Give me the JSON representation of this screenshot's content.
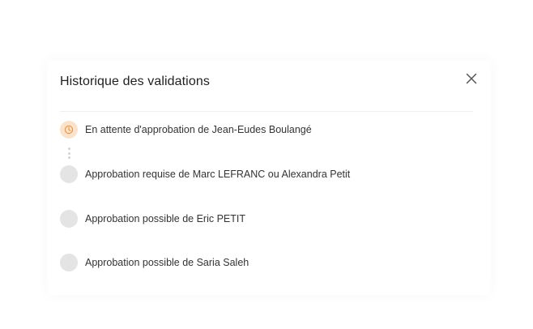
{
  "dialog": {
    "title": "Historique des validations",
    "close_icon": "close-icon"
  },
  "steps": [
    {
      "status": "pending",
      "icon": "clock-icon",
      "label": "En attente d'approbation de Jean-Eudes Boulangé"
    },
    {
      "status": "upcoming",
      "icon": "empty-circle",
      "label": "Approbation requise de Marc LEFRANC ou Alexandra Petit"
    },
    {
      "status": "upcoming",
      "icon": "empty-circle",
      "label": "Approbation possible de Eric PETIT"
    },
    {
      "status": "upcoming",
      "icon": "empty-circle",
      "label": "Approbation possible de Saria Saleh"
    }
  ],
  "colors": {
    "pending_bg": "#fbe3cb",
    "pending_icon": "#e8964a",
    "upcoming_bg": "#e4e4e4"
  }
}
